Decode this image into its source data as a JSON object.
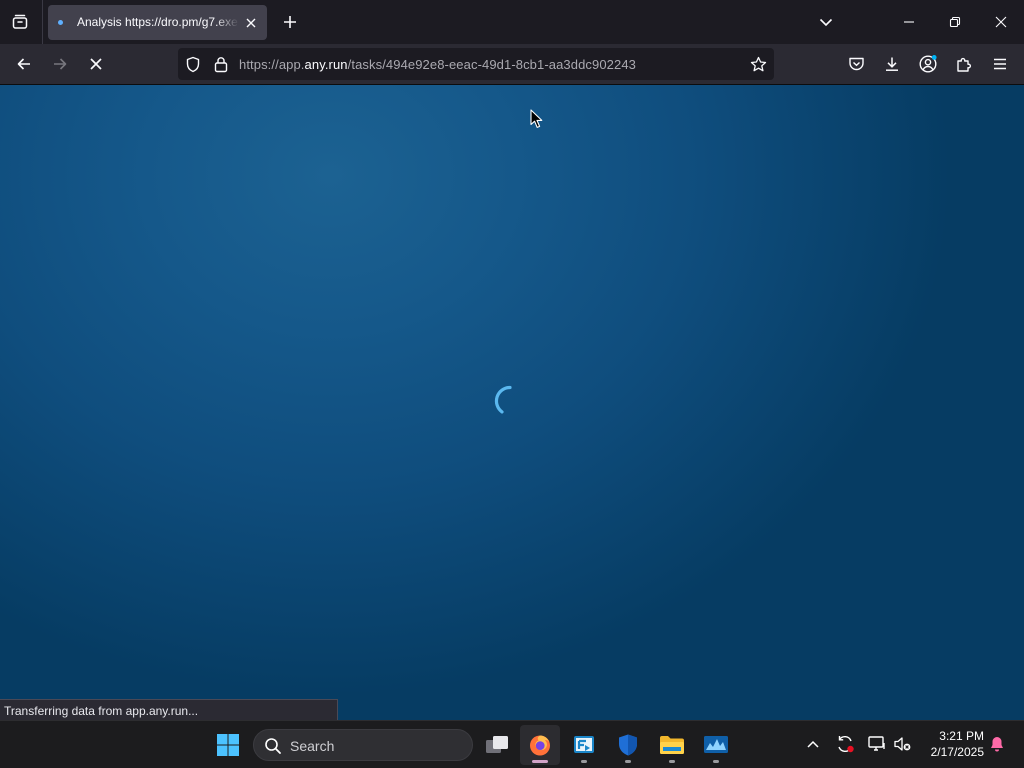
{
  "browser": {
    "tab": {
      "title": "Analysis https://dro.pm/g7.exe"
    },
    "url": {
      "prefix": "https://app.",
      "host": "any.run",
      "path": "/tasks/494e92e8-eeac-49d1-8cb1-aa3ddc902243"
    },
    "status_text": "Transferring data from app.any.run..."
  },
  "icons": {
    "tab_list": "tab-list-icon",
    "new_tab": "plus-icon",
    "list_all_tabs": "chevron-down-icon",
    "back": "back-arrow-icon",
    "forward": "forward-arrow-icon",
    "stop": "stop-icon",
    "tracking_protection": "shield-icon",
    "lock": "lock-icon",
    "bookmark": "star-icon",
    "pocket": "pocket-icon",
    "downloads": "download-icon",
    "account": "account-icon",
    "extensions": "puzzle-icon",
    "menu": "hamburger-icon",
    "loading": "spinner-icon"
  },
  "taskbar": {
    "search_label": "Search",
    "apps": [
      "start",
      "task-view",
      "firefox",
      "anyrun-app",
      "defender",
      "file-explorer",
      "monitor"
    ],
    "clock": {
      "time": "3:21 PM",
      "date": "2/17/2025"
    }
  },
  "colors": {
    "content_bg": "#0f4d7d",
    "spinner": "#5bb8ef",
    "toolbar": "#2b2a33",
    "tabstrip": "#1c1b22"
  }
}
